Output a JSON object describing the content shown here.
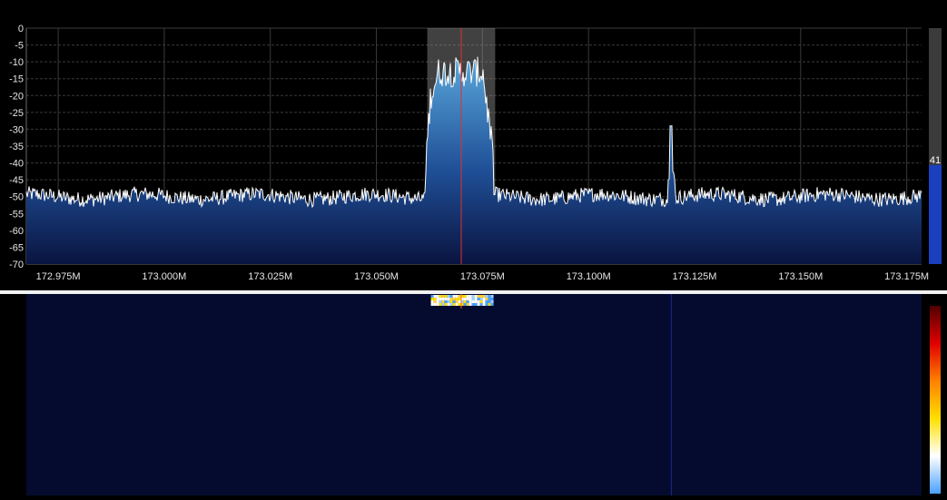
{
  "chart_data": {
    "type": "line",
    "y_axis": {
      "range": [
        -70,
        0
      ],
      "ticks": [
        0,
        -5,
        -10,
        -15,
        -20,
        -25,
        -30,
        -35,
        -40,
        -45,
        -50,
        -55,
        -60,
        -65,
        -70
      ],
      "tick_labels": [
        "0",
        "-5",
        "-10",
        "-15",
        "-20",
        "-25",
        "-30",
        "-35",
        "-40",
        "-45",
        "-50",
        "-55",
        "-60",
        "-65",
        "-70"
      ]
    },
    "x_axis": {
      "range": [
        172.9675,
        173.1785
      ],
      "ticks": [
        172.975,
        173.0,
        173.025,
        173.05,
        173.075,
        173.1,
        173.125,
        173.15,
        173.175
      ],
      "tick_labels": [
        "172.975M",
        "173.000M",
        "173.025M",
        "173.050M",
        "173.075M",
        "173.100M",
        "173.125M",
        "173.150M",
        "173.175M"
      ]
    },
    "grid": true,
    "noise_floor_db": -50,
    "features": [
      {
        "kind": "wideband-signal",
        "start": 173.0615,
        "end": 173.0775,
        "peak_db": -7
      },
      {
        "kind": "narrow-spike",
        "center": 173.1195,
        "peak_db": -29
      }
    ],
    "selection": {
      "start": 173.062,
      "end": 173.078,
      "center": 173.07
    },
    "colors": {
      "trace": "#ffffff",
      "fill_bottom": "#0a1440",
      "fill_top": "#5aa8dc",
      "center_line": "#e03030",
      "selection": "#9a9a9a"
    }
  },
  "level_meter": {
    "value": 41,
    "label": "41",
    "fill_fraction": 0.42,
    "color": "#1a3fbf"
  },
  "waterfall": {
    "background": "#050b2e",
    "spike_line_color": "#1a2a8a",
    "colorbar_colors": [
      "#4aa0ff",
      "#ffffff",
      "#ffe000",
      "#ff8000",
      "#e00000",
      "#500000"
    ]
  }
}
